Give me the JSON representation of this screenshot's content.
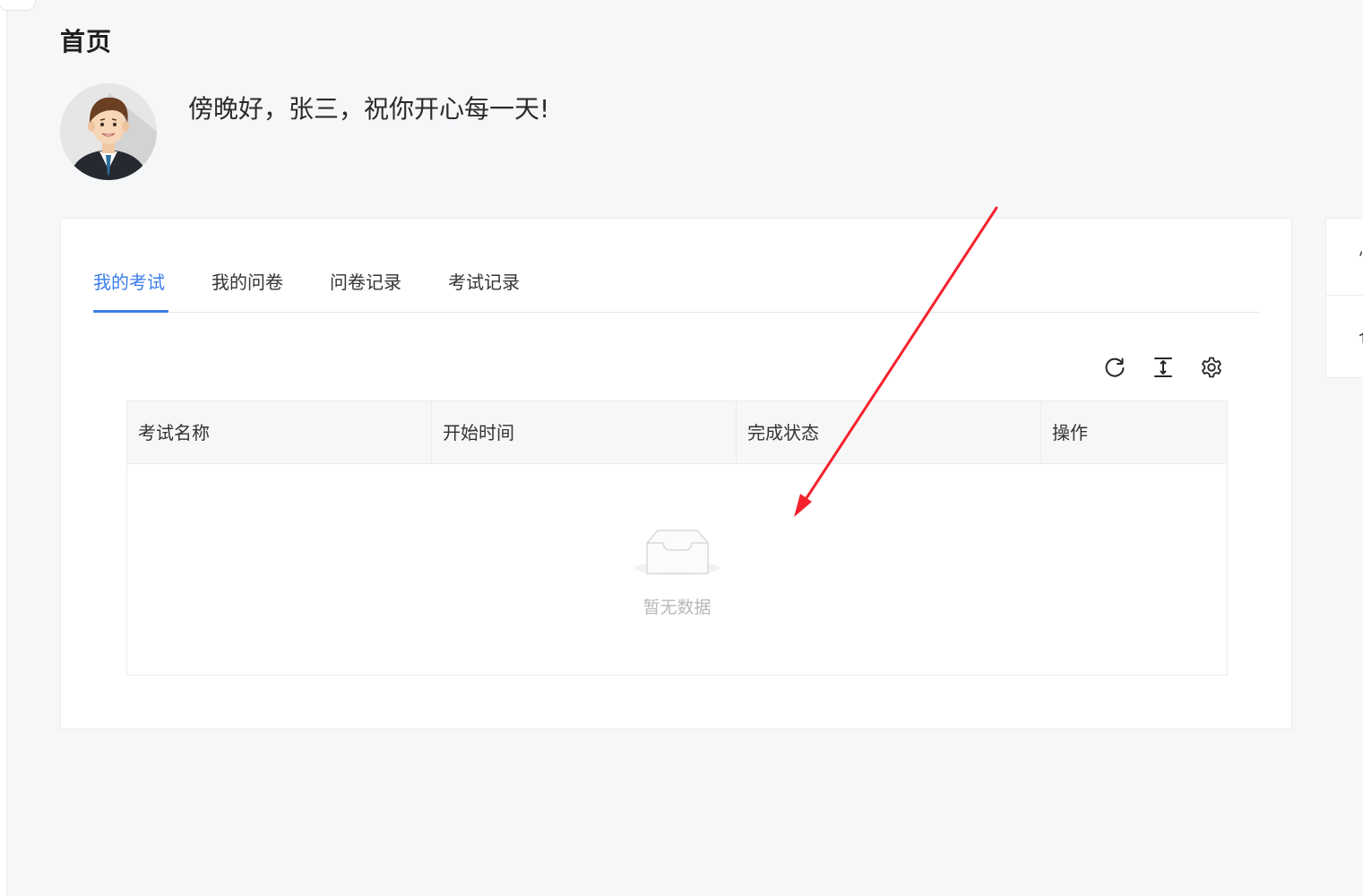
{
  "page": {
    "title": "首页",
    "greeting": "傍晚好，张三，祝你开心每一天!"
  },
  "tabs": [
    {
      "label": "我的考试",
      "active": true
    },
    {
      "label": "我的问卷",
      "active": false
    },
    {
      "label": "问卷记录",
      "active": false
    },
    {
      "label": "考试记录",
      "active": false
    }
  ],
  "toolbar": {
    "icons": [
      "refresh-icon",
      "column-height-icon",
      "settings-icon"
    ]
  },
  "table": {
    "columns": [
      "考试名称",
      "开始时间",
      "完成状态",
      "操作"
    ],
    "rows": [],
    "empty_text": "暂无数据"
  },
  "side_panel": {
    "items": [
      "忄",
      "仓"
    ]
  },
  "colors": {
    "accent": "#3b7de9",
    "annotation_arrow": "#f5222d",
    "page_background": "#f6f7f9"
  }
}
